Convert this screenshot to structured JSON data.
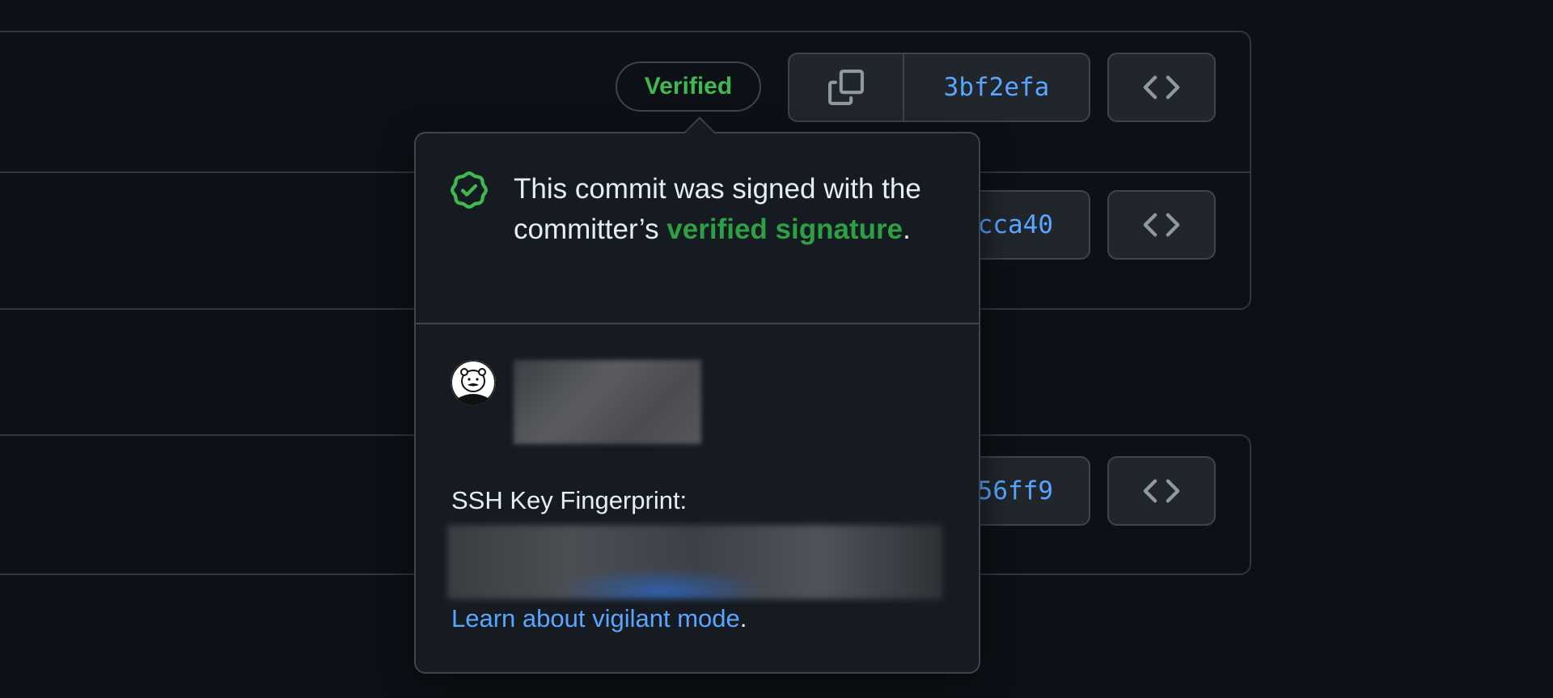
{
  "commits": [
    {
      "sha": "3bf2efa",
      "badge": "Verified"
    },
    {
      "sha": "cca40"
    },
    {
      "sha": "56ff9"
    }
  ],
  "popover": {
    "message_prefix": "This commit was signed with the committer’s ",
    "message_link": "verified signature",
    "message_suffix": ".",
    "ssh_label": "SSH Key Fingerprint:",
    "learn_link": "Learn about vigilant mode",
    "learn_suffix": "."
  },
  "icons": {
    "copy": "copy-icon",
    "code": "code-icon",
    "verified": "verified-shield-icon"
  },
  "colors": {
    "background": "#0d1117",
    "verified_green": "#3fb950",
    "link_blue": "#58a6ff",
    "border": "#3d444d"
  }
}
